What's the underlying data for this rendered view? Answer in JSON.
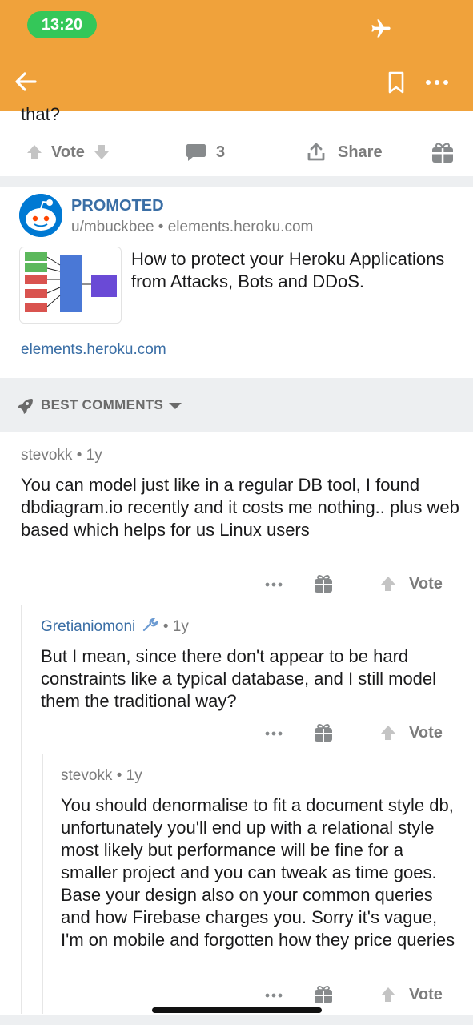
{
  "status": {
    "time": "13:20"
  },
  "icons": {
    "status": "airplane-icon",
    "nav": [
      "back-arrow-icon",
      "bookmark-icon",
      "more-icon"
    ],
    "post": [
      "upvote-icon",
      "downvote-icon",
      "comment-icon",
      "share-icon",
      "gift-icon"
    ],
    "comment": [
      "more-icon",
      "gift-icon",
      "upvote-icon"
    ],
    "best": [
      "rocket-icon",
      "caret-down-icon"
    ]
  },
  "colors": {
    "header": "#f0a23b",
    "status_pill": "#34c759",
    "link": "#3a6ea5",
    "muted": "#7c7c7c"
  },
  "post": {
    "partial_text": "that?",
    "vote_label": "Vote",
    "comment_count": "3",
    "share_label": "Share"
  },
  "promoted": {
    "label": "PROMOTED",
    "byline": "u/mbuckbee • elements.heroku.com",
    "title": "How to protect your Heroku Applications from Attacks, Bots and DDoS.",
    "link": "elements.heroku.com"
  },
  "sort": {
    "label": "BEST COMMENTS"
  },
  "comments": [
    {
      "author": "stevokk",
      "age": "• 1y",
      "body": "You can model just like in a regular DB tool, I found dbdiagram.io recently and it costs me nothing.. plus web based which helps for us Linux users",
      "vote_label": "Vote"
    },
    {
      "author": "Gretianiomoni",
      "age": "• 1y",
      "body": "But I mean, since there don't appear to be hard constraints like a typical database, and I still model them the traditional way?",
      "vote_label": "Vote"
    },
    {
      "author": "stevokk",
      "age": "• 1y",
      "body": "You should denormalise to fit a document style db, unfortunately you'll end up with a relational style most likely but performance will be fine for a smaller project and you can tweak as time goes. Base your design also on your common queries and how Firebase charges you. Sorry it's vague, I'm on mobile and forgotten how they price queries",
      "vote_label": "Vote"
    }
  ]
}
